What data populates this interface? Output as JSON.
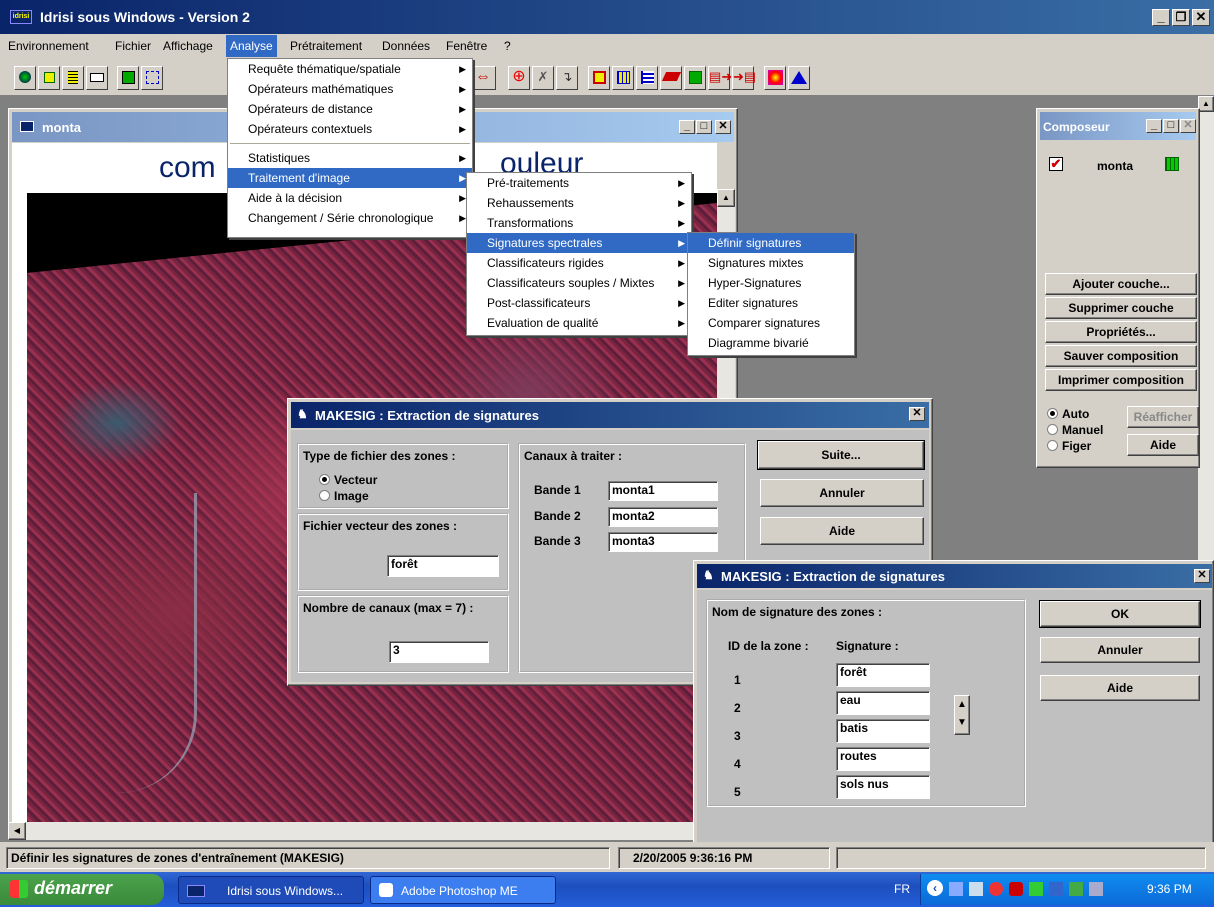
{
  "app": {
    "title": "Idrisi sous Windows  -  Version 2"
  },
  "menubar": {
    "items": [
      "Environnement",
      "Fichier",
      "Affichage",
      "Analyse",
      "Prétraitement",
      "Données",
      "Fenêtre",
      "?"
    ]
  },
  "analyse_menu": {
    "items": [
      "Requête thématique/spatiale",
      "Opérateurs mathématiques",
      "Opérateurs de distance",
      "Opérateurs contextuels",
      "Statistiques",
      "Traitement d'image",
      "Aide à la décision",
      "Changement / Série chronologique"
    ]
  },
  "traitement_menu": {
    "items": [
      "Pré-traitements",
      "Rehaussements",
      "Transformations",
      "Signatures spectrales",
      "Classificateurs rigides",
      "Classificateurs souples / Mixtes",
      "Post-classificateurs",
      "Evaluation de qualité"
    ]
  },
  "signatures_menu": {
    "items": [
      "Définir signatures",
      "Signatures mixtes",
      "Hyper-Signatures",
      "Editer signatures",
      "Comparer signatures",
      "Diagramme bivarié"
    ]
  },
  "image_window": {
    "title": "monta",
    "heading_left": "com",
    "heading_right": "ouleur"
  },
  "composer": {
    "title": "Composeur",
    "layer": "monta",
    "buttons": [
      "Ajouter couche...",
      "Supprimer couche",
      "Propriétés...",
      "Sauver composition",
      "Imprimer composition"
    ],
    "radio": [
      "Auto",
      "Manuel",
      "Figer"
    ],
    "btn_refresh": "Réafficher",
    "btn_help": "Aide"
  },
  "dialog1": {
    "title": "MAKESIG : Extraction de signatures",
    "type_label": "Type de fichier des zones :",
    "opt_vector": "Vecteur",
    "opt_image": "Image",
    "vector_file_label": "Fichier vecteur des zones :",
    "vector_file": "forêt",
    "channels_label": "Nombre de canaux (max = 7) :",
    "channels": "3",
    "bands_label": "Canaux à traiter :",
    "bands": [
      {
        "label": "Bande 1",
        "value": "monta1"
      },
      {
        "label": "Bande 2",
        "value": "monta2"
      },
      {
        "label": "Bande 3",
        "value": "monta3"
      }
    ],
    "btn_next": "Suite...",
    "btn_cancel": "Annuler",
    "btn_help": "Aide"
  },
  "dialog2": {
    "title": "MAKESIG : Extraction de signatures",
    "group_label": "Nom de signature des zones :",
    "col_id": "ID de la zone :",
    "col_sig": "Signature :",
    "rows": [
      {
        "id": "1",
        "sig": "forêt"
      },
      {
        "id": "2",
        "sig": "eau"
      },
      {
        "id": "3",
        "sig": "batis"
      },
      {
        "id": "4",
        "sig": "routes"
      },
      {
        "id": "5",
        "sig": "sols nus"
      }
    ],
    "btn_ok": "OK",
    "btn_cancel": "Annuler",
    "btn_help": "Aide"
  },
  "statusbar": {
    "message": "Définir les signatures de zones d'entraînement (MAKESIG)",
    "datetime": "2/20/2005 9:36:16 PM"
  },
  "taskbar": {
    "start": "démarrer",
    "tasks": [
      "Idrisi sous Windows...",
      "Adobe Photoshop ME"
    ],
    "lang": "FR",
    "clock": "9:36 PM"
  }
}
